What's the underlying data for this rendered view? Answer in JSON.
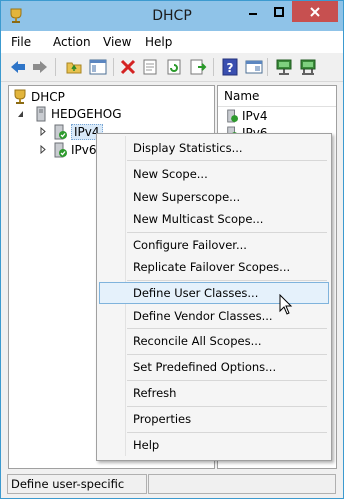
{
  "window": {
    "title": "DHCP",
    "title_bg": "#8fc3e8",
    "close_bg": "#c75050"
  },
  "menubar": {
    "items": [
      "File",
      "Action",
      "View",
      "Help"
    ]
  },
  "toolbar": {
    "icons": [
      "back-arrow-icon",
      "forward-arrow-icon",
      "up-folder-icon",
      "show-hide-tree-icon",
      "delete-icon",
      "properties-icon",
      "refresh-icon",
      "export-list-icon",
      "help-icon",
      "console-view-icon",
      "server-icon",
      "server-network-icon"
    ]
  },
  "tree": {
    "root": "DHCP",
    "server": "HEDGEHOG",
    "nodes": [
      "IPv4",
      "IPv6"
    ]
  },
  "list": {
    "column_name": "Name",
    "rows": [
      "IPv4",
      "IPv6"
    ]
  },
  "context_menu": {
    "groups": [
      [
        "Display Statistics..."
      ],
      [
        "New Scope...",
        "New Superscope...",
        "New Multicast Scope..."
      ],
      [
        "Configure Failover...",
        "Replicate Failover Scopes..."
      ],
      [
        "Define User Classes...",
        "Define Vendor Classes..."
      ],
      [
        "Reconcile All Scopes..."
      ],
      [
        "Set Predefined Options..."
      ],
      [
        "Refresh"
      ],
      [
        "Properties"
      ],
      [
        "Help"
      ]
    ],
    "highlighted": "Define User Classes..."
  },
  "status": {
    "text": "Define user-specific"
  }
}
